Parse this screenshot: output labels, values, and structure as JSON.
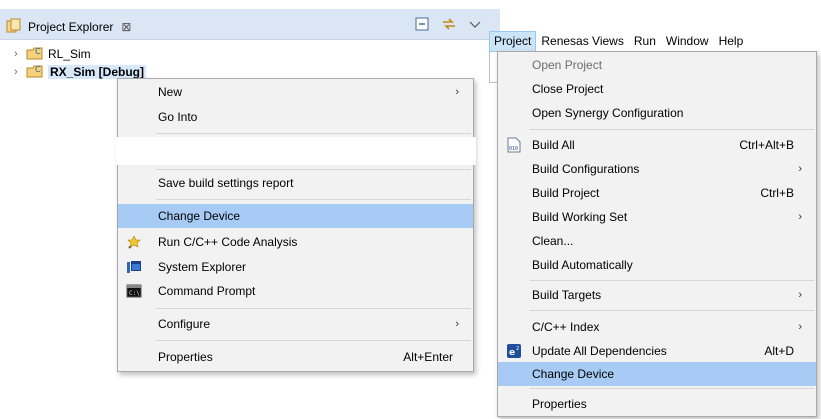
{
  "explorer": {
    "title": "Project Explorer",
    "close_glyph": "⊠",
    "tree": [
      {
        "label": "RL_Sim",
        "chevron": "›",
        "icon": "c-project-icon"
      },
      {
        "label": "RX_Sim [Debug]",
        "chevron": "›",
        "icon": "c-project-icon"
      }
    ]
  },
  "context_menu": {
    "items": [
      {
        "label": "New",
        "submenu": "›"
      },
      {
        "label": "Go Into"
      },
      {
        "label": "Save build settings report"
      },
      {
        "label": "Change Device",
        "highlighted": true
      },
      {
        "label": "Run C/C++ Code Analysis",
        "icon": "code-analysis-icon"
      },
      {
        "label": "System Explorer",
        "icon": "system-explorer-icon"
      },
      {
        "label": "Command Prompt",
        "icon": "command-prompt-icon"
      },
      {
        "label": "Configure",
        "submenu": "›"
      },
      {
        "label": "Properties",
        "shortcut": "Alt+Enter"
      }
    ]
  },
  "menubar": {
    "items": [
      "Project",
      "Renesas Views",
      "Run",
      "Window",
      "Help"
    ]
  },
  "project_menu": {
    "items": [
      {
        "label": "Open Project",
        "disabled": true
      },
      {
        "label": "Close Project"
      },
      {
        "label": "Open Synergy Configuration"
      },
      {
        "label": "Build All",
        "shortcut": "Ctrl+Alt+B",
        "icon": "build-all-icon"
      },
      {
        "label": "Build Configurations",
        "submenu": "›"
      },
      {
        "label": "Build Project",
        "shortcut": "Ctrl+B"
      },
      {
        "label": "Build Working Set",
        "submenu": "›"
      },
      {
        "label": "Clean..."
      },
      {
        "label": "Build Automatically"
      },
      {
        "label": "Build Targets",
        "submenu": "›"
      },
      {
        "label": "C/C++ Index",
        "submenu": "›"
      },
      {
        "label": "Update All Dependencies",
        "shortcut": "Alt+D",
        "icon": "e2-icon"
      },
      {
        "label": "Change Device",
        "highlighted": true
      },
      {
        "label": "Properties"
      }
    ]
  },
  "colors": {
    "highlight": "#a7cbf4",
    "tab_bg": "#dae6f4",
    "menu_bg": "#f2f2f2"
  }
}
